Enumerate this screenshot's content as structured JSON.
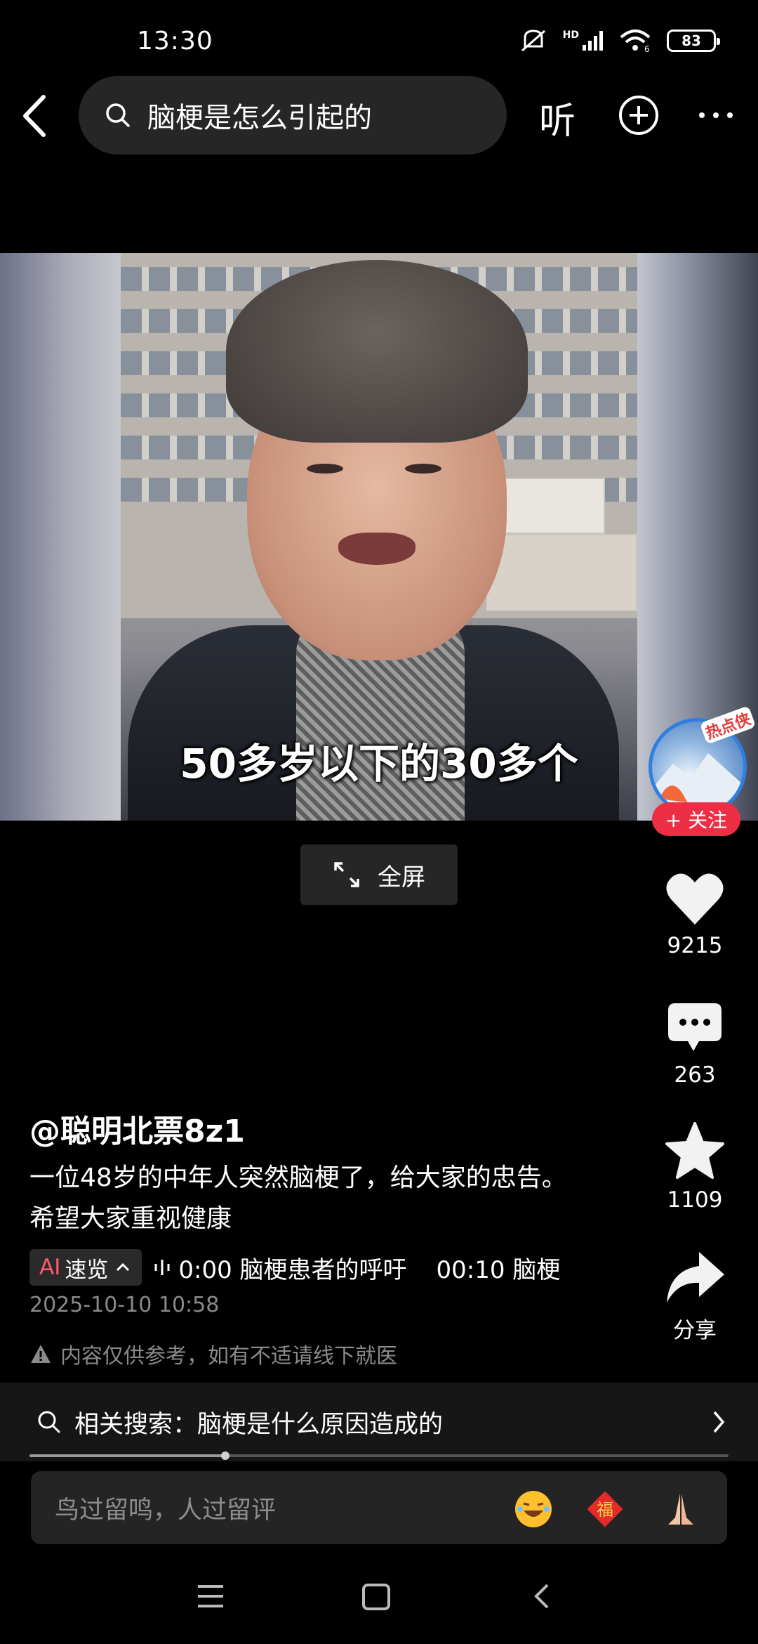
{
  "status_bar": {
    "time": "13:30",
    "network": "HD",
    "battery": "83"
  },
  "search": {
    "query": "脑梗是怎么引起的",
    "listen_label": "听"
  },
  "video": {
    "subtitle": "50多岁以下的30多个",
    "fullscreen_label": "全屏"
  },
  "creator": {
    "badge_text": "热点侠",
    "follow_label": "+ 关注"
  },
  "actions": {
    "likes": "9215",
    "comments": "263",
    "favorites": "1109",
    "share_label": "分享"
  },
  "post": {
    "author": "@聪明北票8z1",
    "description": "一位48岁的中年人突然脑梗了，给大家的忠告。希望大家重视健康",
    "ai_label_ai": "AI",
    "ai_label_text": "速览",
    "chapters": [
      "0:00 脑梗患者的呼吁",
      "00:10 脑梗"
    ],
    "timestamp": "2025-10-10 10:58",
    "disclaimer": "内容仅供参考，如有不适请线下就医"
  },
  "related": {
    "text": "相关搜索：脑梗是什么原因造成的"
  },
  "playback": {
    "progress_fraction": 0.28
  },
  "comment": {
    "placeholder": "鸟过留鸣，人过留评"
  },
  "colors": {
    "accent_red": "#ee2e45",
    "background": "#000000"
  },
  "icons": [
    "back-icon",
    "search-icon",
    "add-circle-icon",
    "more-icon",
    "heart-icon",
    "comment-icon",
    "star-icon",
    "share-icon",
    "expand-icon",
    "warning-icon",
    "chevron-right-icon",
    "laugh-emoji-icon",
    "fu-emoji-icon",
    "pray-emoji-icon",
    "menu-icon",
    "home-square-icon",
    "nav-back-icon"
  ]
}
